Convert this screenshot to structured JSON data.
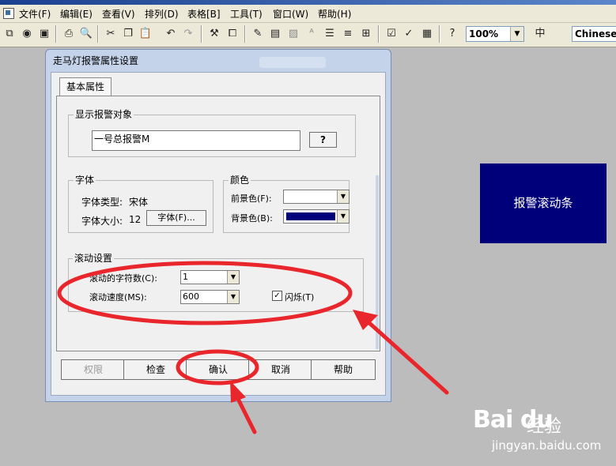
{
  "menubar": {
    "items": [
      "文件(F)",
      "编辑(E)",
      "查看(V)",
      "排列(D)",
      "表格[B]",
      "工具(T)",
      "窗口(W)",
      "帮助(H)"
    ]
  },
  "toolbar": {
    "zoom_value": "100%",
    "language_value": "Chinese",
    "icons": [
      "new-window-icon",
      "database-icon",
      "save-icon",
      "print-icon",
      "print-preview-icon",
      "cut-icon",
      "copy-icon",
      "paste-icon",
      "undo-icon",
      "redo-icon",
      "tools-icon",
      "properties-icon",
      "font-style-icon",
      "format-icon",
      "image-icon",
      "text-size-icon",
      "align-left-icon",
      "align-center-icon",
      "page-setup-icon",
      "check-icon",
      "sort-icon",
      "help-icon",
      "language-icon"
    ]
  },
  "dialog": {
    "title": "走马灯报警属性设置",
    "tab_label": "基本属性",
    "alarm_object": {
      "group_label": "显示报警对象",
      "value": "一号总报警M",
      "browse_label": "?"
    },
    "font": {
      "group_label": "字体",
      "type_label": "字体类型:",
      "type_value": "宋体",
      "size_label": "字体大小:",
      "size_value": "12",
      "button_label": "字体(F)..."
    },
    "color": {
      "group_label": "颜色",
      "fg_label": "前景色(F):",
      "fg_color": "#ffffff",
      "bg_label": "背景色(B):",
      "bg_color": "#00007a"
    },
    "scroll": {
      "group_label": "滚动设置",
      "chars_label": "滚动的字符数(C):",
      "chars_value": "1",
      "speed_label": "滚动速度(MS):",
      "speed_value": "600",
      "flash_label": "闪烁(T)",
      "flash_checked": true
    },
    "buttons": {
      "permission": "权限",
      "check": "检查",
      "confirm": "确认",
      "cancel": "取消",
      "help": "帮助"
    }
  },
  "preview": {
    "text": "报警滚动条",
    "background": "#00007a"
  },
  "watermark": {
    "logo": "Bai du",
    "text": "经验",
    "url": "jingyan.baidu.com"
  },
  "annotation_color": "#e8262b"
}
